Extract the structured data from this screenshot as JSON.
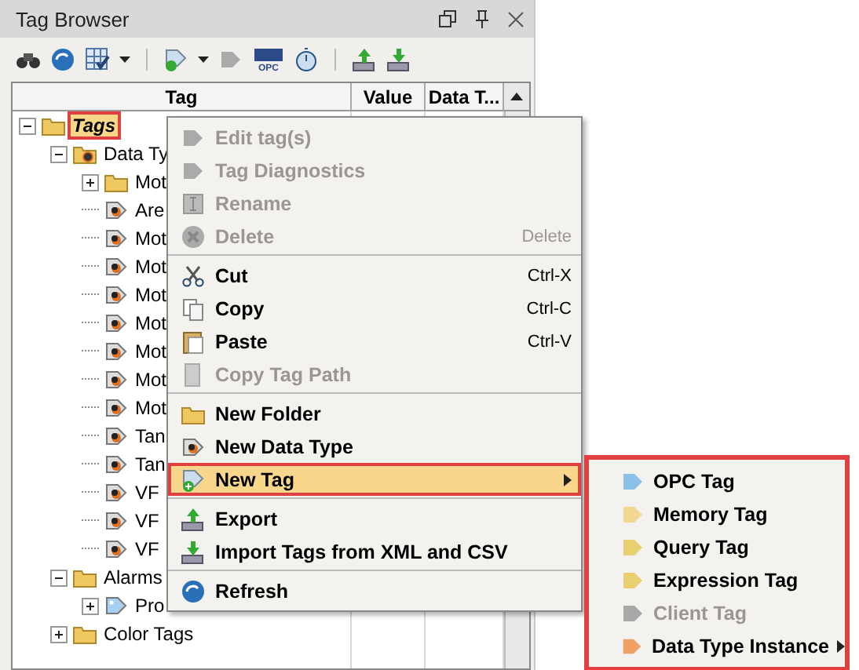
{
  "panel": {
    "title": "Tag Browser"
  },
  "toolbar": {
    "opc_label": "OPC"
  },
  "columns": [
    "Tag",
    "Value",
    "Data T..."
  ],
  "tree": [
    {
      "label": "Tags",
      "kind": "folder",
      "expanded": true,
      "selected": true,
      "children": [
        {
          "label": "Data Ty",
          "kind": "udt-folder",
          "expanded": true,
          "selected": false,
          "children": [
            {
              "label": "Mot",
              "kind": "folder",
              "expanded": false,
              "selected": false
            },
            {
              "label": "Are",
              "kind": "udt",
              "selected": false
            },
            {
              "label": "Mot",
              "kind": "udt",
              "selected": false
            },
            {
              "label": "Mot",
              "kind": "udt",
              "selected": false
            },
            {
              "label": "Mot",
              "kind": "udt",
              "selected": false
            },
            {
              "label": "Mot",
              "kind": "udt",
              "selected": false
            },
            {
              "label": "Mot",
              "kind": "udt",
              "selected": false
            },
            {
              "label": "Mot",
              "kind": "udt",
              "selected": false
            },
            {
              "label": "Mot",
              "kind": "udt",
              "selected": false
            },
            {
              "label": "Tan",
              "kind": "udt",
              "selected": false
            },
            {
              "label": "Tan",
              "kind": "udt",
              "selected": false
            },
            {
              "label": "VF",
              "kind": "udt",
              "selected": false
            },
            {
              "label": "VF",
              "kind": "udt",
              "selected": false
            },
            {
              "label": "VF",
              "kind": "udt",
              "selected": false
            }
          ]
        },
        {
          "label": "Alarms",
          "kind": "folder",
          "expanded": true,
          "selected": false,
          "children": [
            {
              "label": "Pro",
              "kind": "tag",
              "expanded": false,
              "selected": false
            }
          ]
        },
        {
          "label": "Color Tags",
          "kind": "folder",
          "expanded": false,
          "selected": false
        }
      ]
    }
  ],
  "context_menu": [
    {
      "kind": "item",
      "label": "Edit tag(s)",
      "disabled": true
    },
    {
      "kind": "item",
      "label": "Tag Diagnostics",
      "disabled": true
    },
    {
      "kind": "item",
      "label": "Rename",
      "disabled": true
    },
    {
      "kind": "item",
      "label": "Delete",
      "disabled": true,
      "shortcut": "Delete"
    },
    {
      "kind": "separator"
    },
    {
      "kind": "item",
      "label": "Cut",
      "disabled": false,
      "shortcut": "Ctrl-X"
    },
    {
      "kind": "item",
      "label": "Copy",
      "disabled": false,
      "shortcut": "Ctrl-C"
    },
    {
      "kind": "item",
      "label": "Paste",
      "disabled": false,
      "shortcut": "Ctrl-V"
    },
    {
      "kind": "item",
      "label": "Copy Tag Path",
      "disabled": true
    },
    {
      "kind": "separator"
    },
    {
      "kind": "item",
      "label": "New Folder",
      "disabled": false
    },
    {
      "kind": "item",
      "label": "New Data Type",
      "disabled": false
    },
    {
      "kind": "item",
      "label": "New Tag",
      "disabled": false,
      "selected": true,
      "submenu": true
    },
    {
      "kind": "separator"
    },
    {
      "kind": "item",
      "label": "Export",
      "disabled": false
    },
    {
      "kind": "item",
      "label": "Import Tags from XML and CSV",
      "disabled": false
    },
    {
      "kind": "separator"
    },
    {
      "kind": "item",
      "label": "Refresh",
      "disabled": false
    }
  ],
  "submenu": [
    {
      "label": "OPC Tag",
      "disabled": false,
      "color": "#8cc0e8"
    },
    {
      "label": "Memory Tag",
      "disabled": false,
      "color": "#f0d890"
    },
    {
      "label": "Query Tag",
      "disabled": false,
      "color": "#e8d070"
    },
    {
      "label": "Expression Tag",
      "disabled": false,
      "color": "#e8d070"
    },
    {
      "label": "Client Tag",
      "disabled": true,
      "color": "#a8a8a8"
    },
    {
      "label": "Data Type Instance",
      "disabled": false,
      "color": "#f0a060",
      "submenu": true
    }
  ]
}
